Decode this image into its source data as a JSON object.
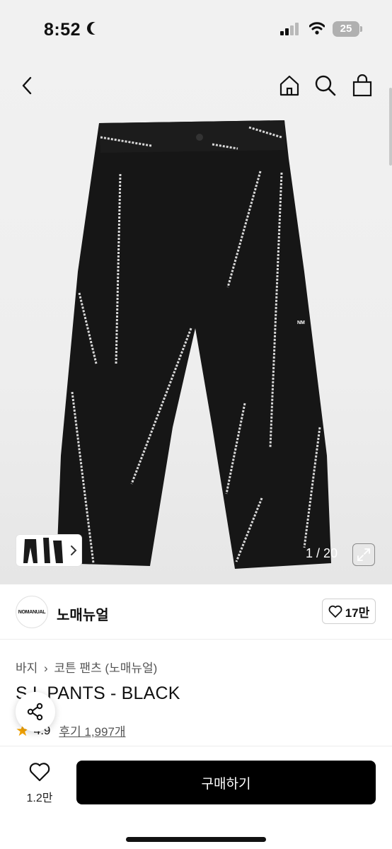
{
  "status_bar": {
    "time": "8:52",
    "battery": "25"
  },
  "header": {
    "back_icon": "chevron-left-icon",
    "home_icon": "home-icon",
    "search_icon": "search-icon",
    "bag_icon": "shopping-bag-icon"
  },
  "gallery": {
    "counter": "1 / 20",
    "thumb_logo": "NM"
  },
  "brand": {
    "logo_text": "NOMANUAL",
    "name": "노매뉴얼",
    "likes": "17만"
  },
  "breadcrumb": {
    "level1": "바지",
    "level2": "코튼 팬츠 (노매뉴얼)"
  },
  "product": {
    "title": "S.L PANTS - BLACK",
    "rating": "4.9",
    "reviews": "후기 1,997개"
  },
  "bottom": {
    "wish_count": "1.2만",
    "buy_label": "구매하기"
  },
  "colors": {
    "accent": "#000000",
    "star": "#f2a200"
  }
}
